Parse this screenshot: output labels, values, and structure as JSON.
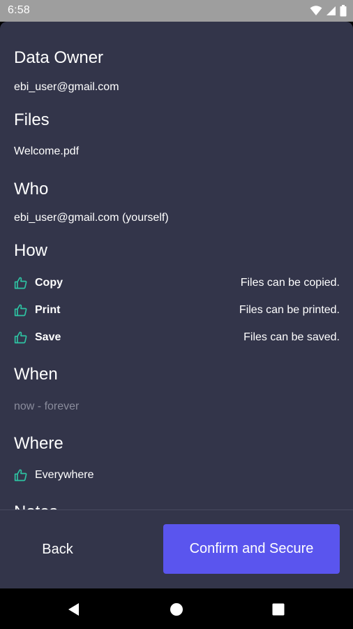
{
  "status_bar": {
    "time": "6:58",
    "icons": [
      "wifi-icon",
      "signal-icon",
      "battery-icon"
    ]
  },
  "sections": {
    "data_owner": {
      "title": "Data Owner",
      "value": "ebi_user@gmail.com"
    },
    "files": {
      "title": "Files",
      "value": "Welcome.pdf"
    },
    "who": {
      "title": "Who",
      "value": "ebi_user@gmail.com (yourself)"
    },
    "how": {
      "title": "How",
      "permissions": [
        {
          "name": "Copy",
          "description": "Files can be copied.",
          "icon": "thumbs-up-icon"
        },
        {
          "name": "Print",
          "description": "Files can be printed.",
          "icon": "thumbs-up-icon"
        },
        {
          "name": "Save",
          "description": "Files can be saved.",
          "icon": "thumbs-up-icon"
        }
      ]
    },
    "when": {
      "title": "When",
      "value": "now - forever"
    },
    "where": {
      "title": "Where",
      "value": "Everywhere",
      "icon": "thumbs-up-icon"
    },
    "notes": {
      "title": "Notes"
    }
  },
  "footer": {
    "back_label": "Back",
    "confirm_label": "Confirm and Secure"
  },
  "colors": {
    "background": "#33354a",
    "accent_button": "#5a55ee",
    "icon_green": "#2ec4a3",
    "muted_text": "#8a8c9c",
    "status_bar": "#9e9e9e"
  },
  "nav_bar": {
    "buttons": [
      "back-triangle-icon",
      "home-circle-icon",
      "recents-square-icon"
    ]
  }
}
